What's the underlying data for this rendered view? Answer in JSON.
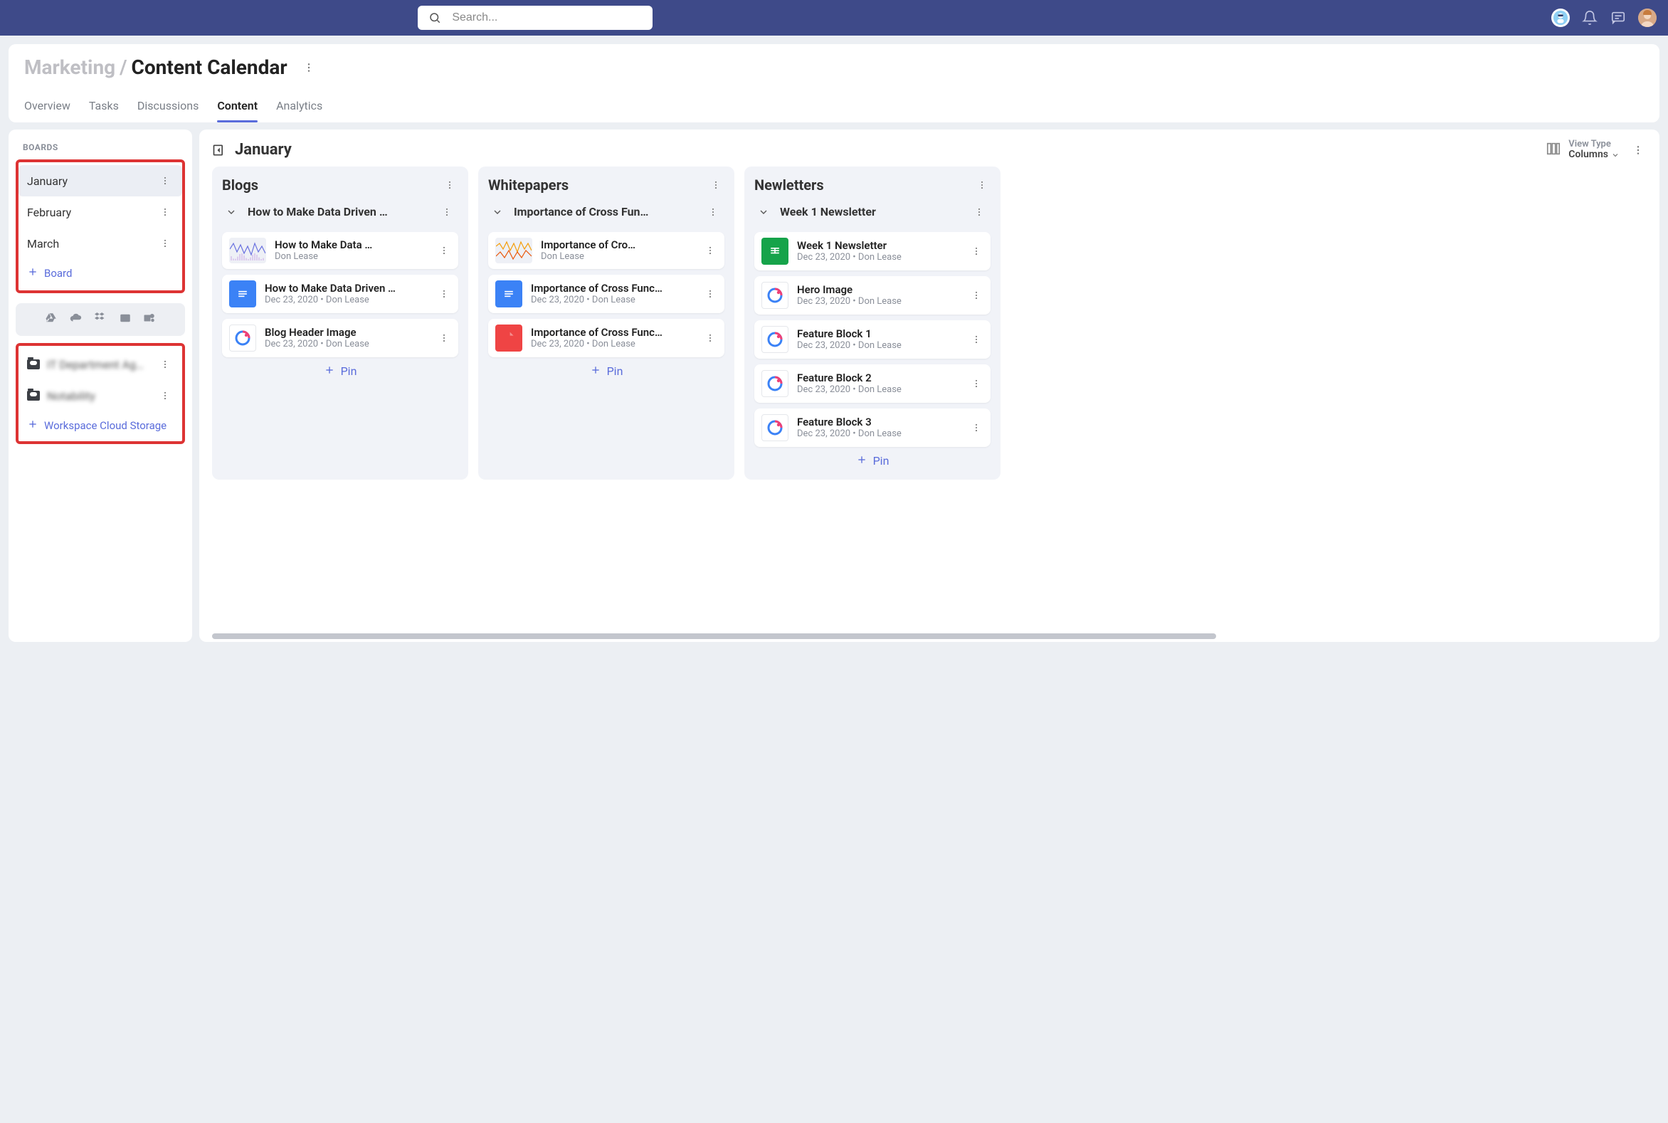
{
  "search": {
    "placeholder": "Search..."
  },
  "breadcrumb": {
    "parent": "Marketing",
    "sep": "/",
    "current": "Content Calendar"
  },
  "tabs": [
    "Overview",
    "Tasks",
    "Discussions",
    "Content",
    "Analytics"
  ],
  "active_tab": "Content",
  "sidebar": {
    "label": "BOARDS",
    "boards": [
      "January",
      "February",
      "March"
    ],
    "selected": "January",
    "add_board": "Board",
    "folders": [
      "IT Department Ag…",
      "Notability"
    ],
    "add_cloud": "Workspace Cloud Storage"
  },
  "main": {
    "title": "January",
    "view_type_label": "View Type",
    "view_type_value": "Columns"
  },
  "pin_label": "Pin",
  "columns": [
    {
      "title": "Blogs",
      "group": "How to Make Data Driven …",
      "cards": [
        {
          "icon": "spark-blue",
          "title": "How to Make Data …",
          "meta": "Don Lease"
        },
        {
          "icon": "doc",
          "title": "How to Make Data Driven …",
          "meta": "Dec 23, 2020 • Don Lease"
        },
        {
          "icon": "app",
          "title": "Blog Header Image",
          "meta": "Dec 23, 2020 • Don Lease"
        }
      ]
    },
    {
      "title": "Whitepapers",
      "group": "Importance of Cross Fun…",
      "cards": [
        {
          "icon": "spark-orange",
          "title": "Importance of Cro…",
          "meta": "Don Lease"
        },
        {
          "icon": "doc",
          "title": "Importance of Cross Func…",
          "meta": "Dec 23, 2020 • Don Lease"
        },
        {
          "icon": "pdf",
          "title": "Importance of Cross Func…",
          "meta": "Dec 23, 2020 • Don Lease"
        }
      ]
    },
    {
      "title": "Newletters",
      "group": "Week 1 Newsletter",
      "cards": [
        {
          "icon": "sheet",
          "title": "Week 1 Newsletter",
          "meta": "Dec 23, 2020 • Don Lease"
        },
        {
          "icon": "app",
          "title": "Hero Image",
          "meta": "Dec 23, 2020 • Don Lease"
        },
        {
          "icon": "app",
          "title": "Feature Block 1",
          "meta": "Dec 23, 2020 • Don Lease"
        },
        {
          "icon": "app",
          "title": "Feature Block 2",
          "meta": "Dec 23, 2020 • Don Lease"
        },
        {
          "icon": "app",
          "title": "Feature Block 3",
          "meta": "Dec 23, 2020 • Don Lease"
        }
      ]
    }
  ]
}
